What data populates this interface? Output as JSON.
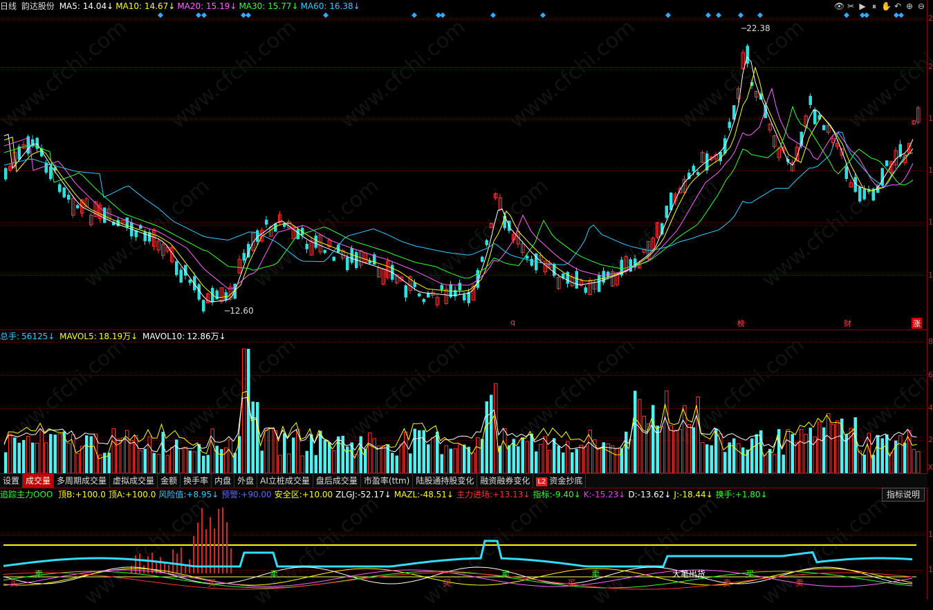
{
  "header": {
    "period": "日线",
    "stock": "韵达股份",
    "ma": [
      {
        "label": "MA5:",
        "value": "14.04",
        "arrow": "↓",
        "color": "#ffffff"
      },
      {
        "label": "MA10:",
        "value": "14.67",
        "arrow": "↓",
        "color": "#ffff00"
      },
      {
        "label": "MA20:",
        "value": "15.19",
        "arrow": "↓",
        "color": "#ff66ff"
      },
      {
        "label": "MA30:",
        "value": "15.77",
        "arrow": "↓",
        "color": "#33ff33"
      },
      {
        "label": "MA60:",
        "value": "16.38",
        "arrow": "↓",
        "color": "#33ccff"
      }
    ]
  },
  "price_chart": {
    "high_label": "22.38",
    "low_label": "12.60",
    "axis_ticks": [
      "2",
      "2",
      "1",
      "1",
      "1",
      "1"
    ],
    "flags": [
      "q",
      "榜",
      "财",
      "涨"
    ]
  },
  "volume_chart": {
    "total_label": "总手:",
    "total_value": "56125",
    "total_arrow": "↓",
    "mavol5_label": "MAVOL5:",
    "mavol5_value": "18.19万",
    "mavol5_arrow": "↓",
    "mavol10_label": "MAVOL10:",
    "mavol10_value": "12.86万",
    "mavol10_arrow": "↓",
    "axis_ticks": [
      "8",
      "6",
      "4",
      "2",
      "X"
    ]
  },
  "tabs": [
    "设置",
    "成交量",
    "多周期成交量",
    "虚拟成交量",
    "金额",
    "换手率",
    "内盘",
    "外盘",
    "AI立桩成交量",
    "盘后成交量",
    "市盈率(ttm)",
    "陆股通持股变化",
    "融资融券变化",
    "资金抄底"
  ],
  "active_tab": "成交量",
  "l2_badge": "L2",
  "indicator": {
    "name": "追踪主力OOO",
    "items": [
      {
        "label": "顶B:",
        "value": "+100.0",
        "color": "#ffff00"
      },
      {
        "label": "顶A:",
        "value": "+100.0",
        "color": "#ffff00"
      },
      {
        "label": "风险值:",
        "value": "+8.95",
        "arrow": "↓",
        "color": "#33ccff"
      },
      {
        "label": "预警:",
        "value": "+90.00",
        "color": "#6666ff"
      },
      {
        "label": "安全区:",
        "value": "+10.00",
        "color": "#ffff00"
      },
      {
        "label": "ZLGJ:",
        "value": "-52.17",
        "arrow": "↓",
        "color": "#ffffff"
      },
      {
        "label": "MAZL:",
        "value": "-48.51",
        "arrow": "↓",
        "color": "#ffff00"
      },
      {
        "label": "主力进场:",
        "value": "+13.13",
        "arrow": "↓",
        "color": "#ff3333"
      },
      {
        "label": "指标:",
        "value": "-9.40",
        "arrow": "↓",
        "color": "#33ff33"
      },
      {
        "label": "K:",
        "value": "-15.23",
        "arrow": "↓",
        "color": "#ff33ff"
      },
      {
        "label": "D:",
        "value": "-13.62",
        "arrow": "↓",
        "color": "#ffffff"
      },
      {
        "label": "J:",
        "value": "-18.44",
        "arrow": "↓",
        "color": "#ffff00"
      },
      {
        "label": "换手:",
        "value": "+1.80",
        "arrow": "↓",
        "color": "#33ff33"
      }
    ],
    "help": "指标说明",
    "axis_ticks": [
      "1",
      "1"
    ],
    "signals": [
      "买",
      "卖",
      "买",
      "卖",
      "买",
      "卖",
      "买",
      "卖",
      "卖",
      "买",
      "卖"
    ],
    "note": "大笔出货"
  },
  "watermark": "www.cfchi.com",
  "tools": [
    "eye-icon",
    "scissors-icon",
    "play-icon",
    "pause-icon",
    "hand-icon",
    "undo-icon",
    "plus-icon",
    "minus-icon"
  ]
}
